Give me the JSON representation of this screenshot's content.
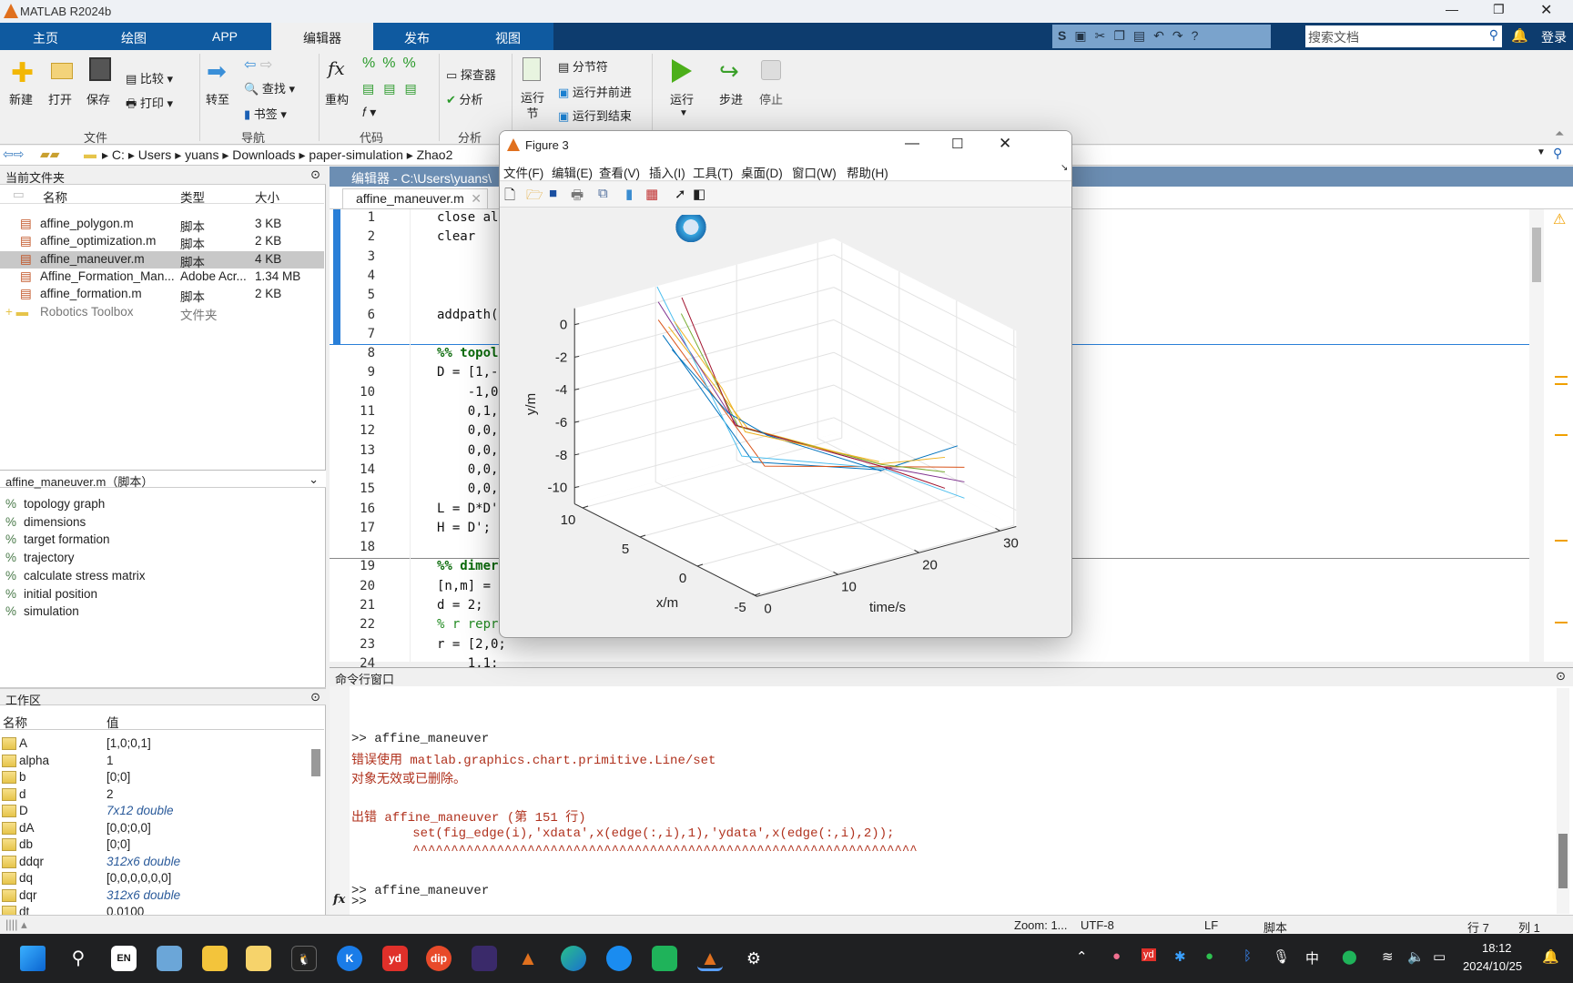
{
  "app": {
    "title": "MATLAB R2024b"
  },
  "tabs": [
    {
      "label": "主页"
    },
    {
      "label": "绘图"
    },
    {
      "label": "APP"
    },
    {
      "label": "编辑器",
      "active": true
    },
    {
      "label": "发布"
    },
    {
      "label": "视图"
    }
  ],
  "quick": {
    "search_placeholder": "搜索文档",
    "login": "登录"
  },
  "ribbon": {
    "new": "新建",
    "open": "打开",
    "save": "保存",
    "compare": "比较",
    "print": "打印",
    "goto": "转至",
    "find": "查找",
    "bookmark": "书签",
    "refactor": "重构",
    "explorer": "探查器",
    "analyze": "分析",
    "run_section": "运行\n节",
    "section_break": "分节符",
    "run_advance": "运行并前进",
    "run_to_end": "运行到结束",
    "run": "运行",
    "step": "步进",
    "stop": "停止",
    "groups": {
      "file": "文件",
      "nav": "导航",
      "code": "代码",
      "analyze": "分析"
    }
  },
  "address": {
    "segments": [
      "C:",
      "Users",
      "yuans",
      "Downloads",
      "paper-simulation",
      "Zhao2"
    ]
  },
  "current_folder": {
    "title": "当前文件夹",
    "columns": {
      "name": "名称",
      "type": "类型",
      "size": "大小"
    },
    "files": [
      {
        "name": "affine_polygon.m",
        "type": "脚本",
        "size": "3 KB"
      },
      {
        "name": "affine_optimization.m",
        "type": "脚本",
        "size": "2 KB"
      },
      {
        "name": "affine_maneuver.m",
        "type": "脚本",
        "size": "4 KB",
        "selected": true
      },
      {
        "name": "Affine_Formation_Man...",
        "type": "Adobe Acr...",
        "size": "1.34 MB"
      },
      {
        "name": "affine_formation.m",
        "type": "脚本",
        "size": "2 KB"
      },
      {
        "name": "Robotics Toolbox",
        "type": "文件夹",
        "size": ""
      }
    ]
  },
  "details": {
    "title": "affine_maneuver.m（脚本）",
    "sections": [
      "topology graph",
      "dimensions",
      "target formation",
      "trajectory",
      "calculate stress matrix",
      "initial position",
      "simulation"
    ]
  },
  "workspace": {
    "title": "工作区",
    "columns": {
      "name": "名称",
      "value": "值"
    },
    "vars": [
      {
        "name": "A",
        "value": "[1,0;0,1]"
      },
      {
        "name": "alpha",
        "value": "1"
      },
      {
        "name": "b",
        "value": "[0;0]"
      },
      {
        "name": "d",
        "value": "2"
      },
      {
        "name": "D",
        "value": "7x12 double",
        "italic": true
      },
      {
        "name": "dA",
        "value": "[0,0;0,0]"
      },
      {
        "name": "db",
        "value": "[0;0]"
      },
      {
        "name": "ddqr",
        "value": "312x6 double",
        "italic": true
      },
      {
        "name": "dq",
        "value": "[0,0,0,0,0,0]"
      },
      {
        "name": "dqr",
        "value": "312x6 double",
        "italic": true
      },
      {
        "name": "dt",
        "value": "0.0100"
      }
    ]
  },
  "editor": {
    "title": "编辑器 - C:\\Users\\yuans\\",
    "tab": "affine_maneuver.m",
    "lines": [
      {
        "n": "1",
        "text": "close al"
      },
      {
        "n": "2",
        "text": "clear"
      },
      {
        "n": "3",
        "text": ""
      },
      {
        "n": "4",
        "text": ""
      },
      {
        "n": "5",
        "text": ""
      },
      {
        "n": "6",
        "text": "addpath("
      },
      {
        "n": "7",
        "text": ""
      },
      {
        "n": "8",
        "text": "%% topol",
        "kind": "sec"
      },
      {
        "n": "9",
        "text": "D = [1,-"
      },
      {
        "n": "10",
        "text": "    -1,0"
      },
      {
        "n": "11",
        "text": "    0,1,"
      },
      {
        "n": "12",
        "text": "    0,0,"
      },
      {
        "n": "13",
        "text": "    0,0,"
      },
      {
        "n": "14",
        "text": "    0,0,"
      },
      {
        "n": "15",
        "text": "    0,0,"
      },
      {
        "n": "16",
        "text": "L = D*D'"
      },
      {
        "n": "17",
        "text": "H = D';"
      },
      {
        "n": "18",
        "text": ""
      },
      {
        "n": "19",
        "text": "%% dimer",
        "kind": "sec"
      },
      {
        "n": "20",
        "text": "[n,m] ="
      },
      {
        "n": "21",
        "text": "d = 2;"
      },
      {
        "n": "22",
        "text": "% r repr",
        "kind": "cmt"
      },
      {
        "n": "23",
        "text": "r = [2,0;"
      },
      {
        "n": "24",
        "text": "    1,1;"
      }
    ]
  },
  "command": {
    "title": "命令行窗口",
    "lines": [
      {
        "text": ">> affine_maneuver",
        "kind": "in"
      },
      {
        "text": "错误使用 matlab.graphics.chart.primitive.Line/set",
        "kind": "err"
      },
      {
        "text": "对象无效或已删除。",
        "kind": "err"
      },
      {
        "text": "出错 affine_maneuver (第 151 行)",
        "kind": "err"
      },
      {
        "text": "        set(fig_edge(i),'xdata',x(edge(:,i),1),'ydata',x(edge(:,i),2));",
        "kind": "err"
      },
      {
        "text": "        ^^^^^^^^^^^^^^^^^^^^^^^^^^^^^^^^^^^^^^^^^^^^^^^^^^^^^^^^^^^^^^^^^^",
        "kind": "err"
      },
      {
        "text": ">> affine_maneuver",
        "kind": "in"
      }
    ],
    "prompt": ">>"
  },
  "status": {
    "zoom": "Zoom: 1...",
    "encoding": "UTF-8",
    "eol": "LF",
    "type": "脚本",
    "row": "行  7",
    "col": "列  1"
  },
  "figure": {
    "title": "Figure 3",
    "menu": [
      "文件(F)",
      "编辑(E)",
      "查看(V)",
      "插入(I)",
      "工具(T)",
      "桌面(D)",
      "窗口(W)",
      "帮助(H)"
    ]
  },
  "chart_data": {
    "type": "line3d",
    "xlabel": "time/s",
    "ylabel": "x/m",
    "zlabel": "y/m",
    "time_ticks": [
      0,
      10,
      20,
      30
    ],
    "x_ticks": [
      -5,
      0,
      5,
      10
    ],
    "y_ticks": [
      -10,
      -8,
      -6,
      -4,
      -2,
      0
    ],
    "time_lim": [
      0,
      32
    ],
    "x_lim": [
      -5.2,
      10.7
    ],
    "y_lim": [
      -11,
      1
    ],
    "grid": true,
    "series": [
      {
        "color": "#0072BD",
        "points": [
          [
            0,
            3.0,
            2.1
          ],
          [
            12,
            3.6,
            -7.5
          ],
          [
            24,
            0.8,
            -8.6
          ],
          [
            30,
            -1.5,
            -7.1
          ]
        ]
      },
      {
        "color": "#D95319",
        "points": [
          [
            0,
            3.4,
            2.9
          ],
          [
            12,
            2.6,
            -7.4
          ],
          [
            24,
            0.8,
            -8.4
          ],
          [
            30,
            -2.1,
            -8.2
          ]
        ]
      },
      {
        "color": "#EDB120",
        "points": [
          [
            0,
            2.5,
            2.8
          ],
          [
            12,
            4.1,
            -5.6
          ],
          [
            24,
            1.0,
            -8.3
          ],
          [
            30,
            -0.4,
            -8.2
          ]
        ]
      },
      {
        "color": "#7E2F8E",
        "points": [
          [
            0,
            3.4,
            4.0
          ],
          [
            12,
            5.0,
            -5.8
          ],
          [
            24,
            0.8,
            -8.4
          ],
          [
            30,
            -2.1,
            -9.1
          ]
        ]
      },
      {
        "color": "#77AC30",
        "points": [
          [
            0,
            1.4,
            4.0
          ],
          [
            12,
            4.9,
            -5.8
          ],
          [
            24,
            0.9,
            -8.3
          ],
          [
            30,
            -0.4,
            -9.1
          ]
        ]
      },
      {
        "color": "#4DBEEE",
        "points": [
          [
            0,
            3.5,
            4.9
          ],
          [
            12,
            4.6,
            -7.5
          ],
          [
            24,
            0.8,
            -8.5
          ],
          [
            30,
            -2.1,
            -10.1
          ]
        ]
      },
      {
        "color": "#A2142F",
        "points": [
          [
            0,
            1.35,
            5.0
          ],
          [
            12,
            5.2,
            -5.8
          ],
          [
            24,
            0.8,
            -8.4
          ],
          [
            30,
            -0.4,
            -10.1
          ]
        ]
      },
      {
        "color": "#0072BD",
        "points": [
          [
            0,
            2.2,
            1.5
          ],
          [
            10,
            4.4,
            -4.5
          ],
          [
            14,
            3.8,
            -6.2
          ],
          [
            24,
            0.9,
            -8.7
          ]
        ]
      },
      {
        "color": "#EDB120",
        "points": [
          [
            0,
            2.0,
            3.3
          ],
          [
            8,
            3.5,
            -2.4
          ],
          [
            12,
            4.3,
            -5.9
          ],
          [
            24,
            1.1,
            -8.2
          ]
        ]
      }
    ]
  },
  "taskbar": {
    "lang": "EN",
    "ime": "中",
    "time": "18:12",
    "date": "2024/10/25"
  },
  "colors": {
    "tab_blue": "#0f5aa0",
    "header_navy": "#0d3c6e",
    "editor_title": "#6c8eb3",
    "error_red": "#b0321e"
  }
}
